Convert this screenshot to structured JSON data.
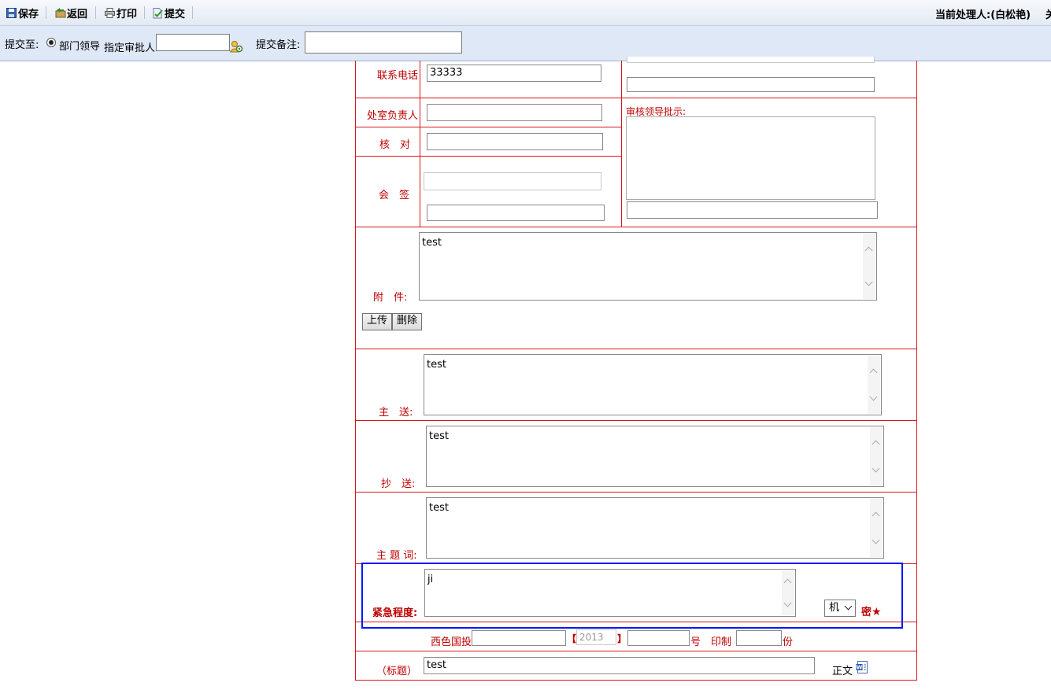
{
  "toolbar": {
    "save": "保存",
    "back": "返回",
    "print": "打印",
    "submit": "提交",
    "handler": "当前处理人:(白松艳)",
    "handler_extra": "关"
  },
  "submit_bar": {
    "submit_to_label": "提交至:",
    "option_dept_leader": "部门领导",
    "approver_label": "指定审批人:",
    "approver_value": "",
    "note_label": "提交备注:",
    "note_value": ""
  },
  "form": {
    "phone_label": "联系电话",
    "phone_value": "33333",
    "office_head_label": "处室负责人",
    "office_head_value": "",
    "check_label": "核　对",
    "check_value": "",
    "countersign_label": "会　签",
    "review_label": "审核领导批示:",
    "attachment_label": "附　件:",
    "attachment_value": "test",
    "upload_button": "上传",
    "delete_button": "删除",
    "main_send_label": "主　送:",
    "main_send_value": "test",
    "cc_label": "抄　送:",
    "cc_value": "test",
    "keywords_label": "主 题 词:",
    "keywords_value": "test",
    "urgency_label": "紧急程度:",
    "urgency_value": "ji",
    "secret_select_value": "机",
    "secret_label": "密",
    "doc_prefix": "西色国投",
    "year_open": "【",
    "year_value": "2013",
    "year_close": "】",
    "number_suffix": "号",
    "print_label": "印制",
    "copies_suffix": "份",
    "title_label": "（标题）",
    "title_value": "test",
    "body_label": "正文"
  }
}
